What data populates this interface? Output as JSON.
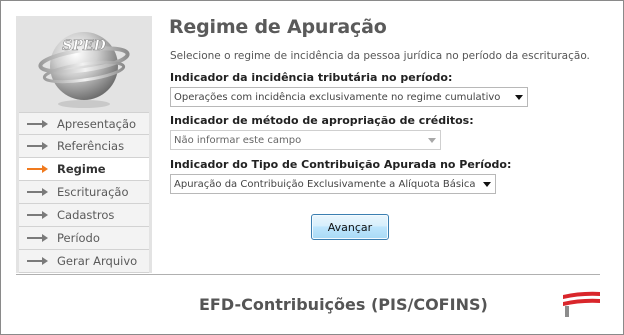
{
  "page": {
    "title": "Regime de Apuração",
    "subtitle": "Selecione o regime de incidência da pessoa jurídica no período da escrituração."
  },
  "sidebar": {
    "logo_text": "SPED",
    "items": [
      {
        "label": "Apresentação",
        "active": false
      },
      {
        "label": "Referências",
        "active": false
      },
      {
        "label": "Regime",
        "active": true
      },
      {
        "label": "Escrituração",
        "active": false
      },
      {
        "label": "Cadastros",
        "active": false
      },
      {
        "label": "Período",
        "active": false
      },
      {
        "label": "Gerar Arquivo",
        "active": false
      }
    ]
  },
  "form": {
    "incidencia": {
      "label": "Indicador da incidência tributária no período:",
      "value": "Operações com incidência exclusivamente no regime cumulativo",
      "enabled": true
    },
    "apropriacao": {
      "label": "Indicador de método de apropriação de créditos:",
      "value": "Não informar este campo",
      "enabled": false
    },
    "contribuicao": {
      "label": "Indicador do Tipo de Contribuição Apurada no Período:",
      "value": "Apuração da Contribuição Exclusivamente a Alíquota Básica",
      "enabled": true
    }
  },
  "actions": {
    "next_label": "Avançar"
  },
  "footer": {
    "title": "EFD-Contribuições (PIS/COFINS)"
  },
  "colors": {
    "active_arrow": "#f07a1e",
    "inactive_arrow": "#7a7a7a",
    "sidebar_bg": "#e3e3e3",
    "button_border": "#3c7fb1",
    "logo_red": "#d9262b"
  },
  "icons": {
    "nav_arrow": "arrow-right-icon",
    "select_caret": "chevron-down-icon",
    "sped_logo": "sped-globe-logo",
    "footer_logo": "receita-federal-logo"
  }
}
